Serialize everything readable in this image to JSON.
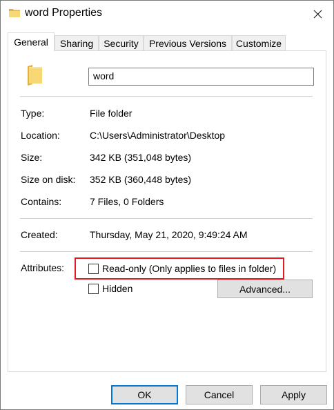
{
  "window": {
    "title": "word Properties",
    "close_icon": "close-icon"
  },
  "tabs": [
    {
      "label": "General",
      "active": true
    },
    {
      "label": "Sharing",
      "active": false
    },
    {
      "label": "Security",
      "active": false
    },
    {
      "label": "Previous Versions",
      "active": false
    },
    {
      "label": "Customize",
      "active": false
    }
  ],
  "general": {
    "folder_icon": "folder-icon",
    "name_value": "word",
    "type_label": "Type:",
    "type_value": "File folder",
    "location_label": "Location:",
    "location_value": "C:\\Users\\Administrator\\Desktop",
    "size_label": "Size:",
    "size_value": "342 KB (351,048 bytes)",
    "size_on_disk_label": "Size on disk:",
    "size_on_disk_value": "352 KB (360,448 bytes)",
    "contains_label": "Contains:",
    "contains_value": "7 Files, 0 Folders",
    "created_label": "Created:",
    "created_value": "Thursday, May 21, 2020, 9:49:24 AM",
    "attributes_label": "Attributes:",
    "readonly_label": "Read-only (Only applies to files in folder)",
    "readonly_checked": false,
    "hidden_label": "Hidden",
    "hidden_checked": false,
    "advanced_label": "Advanced..."
  },
  "footer": {
    "ok_label": "OK",
    "cancel_label": "Cancel",
    "apply_label": "Apply"
  },
  "colors": {
    "highlight": "#e01b24",
    "default_button_border": "#0078d7",
    "folder": "#f8d775"
  }
}
